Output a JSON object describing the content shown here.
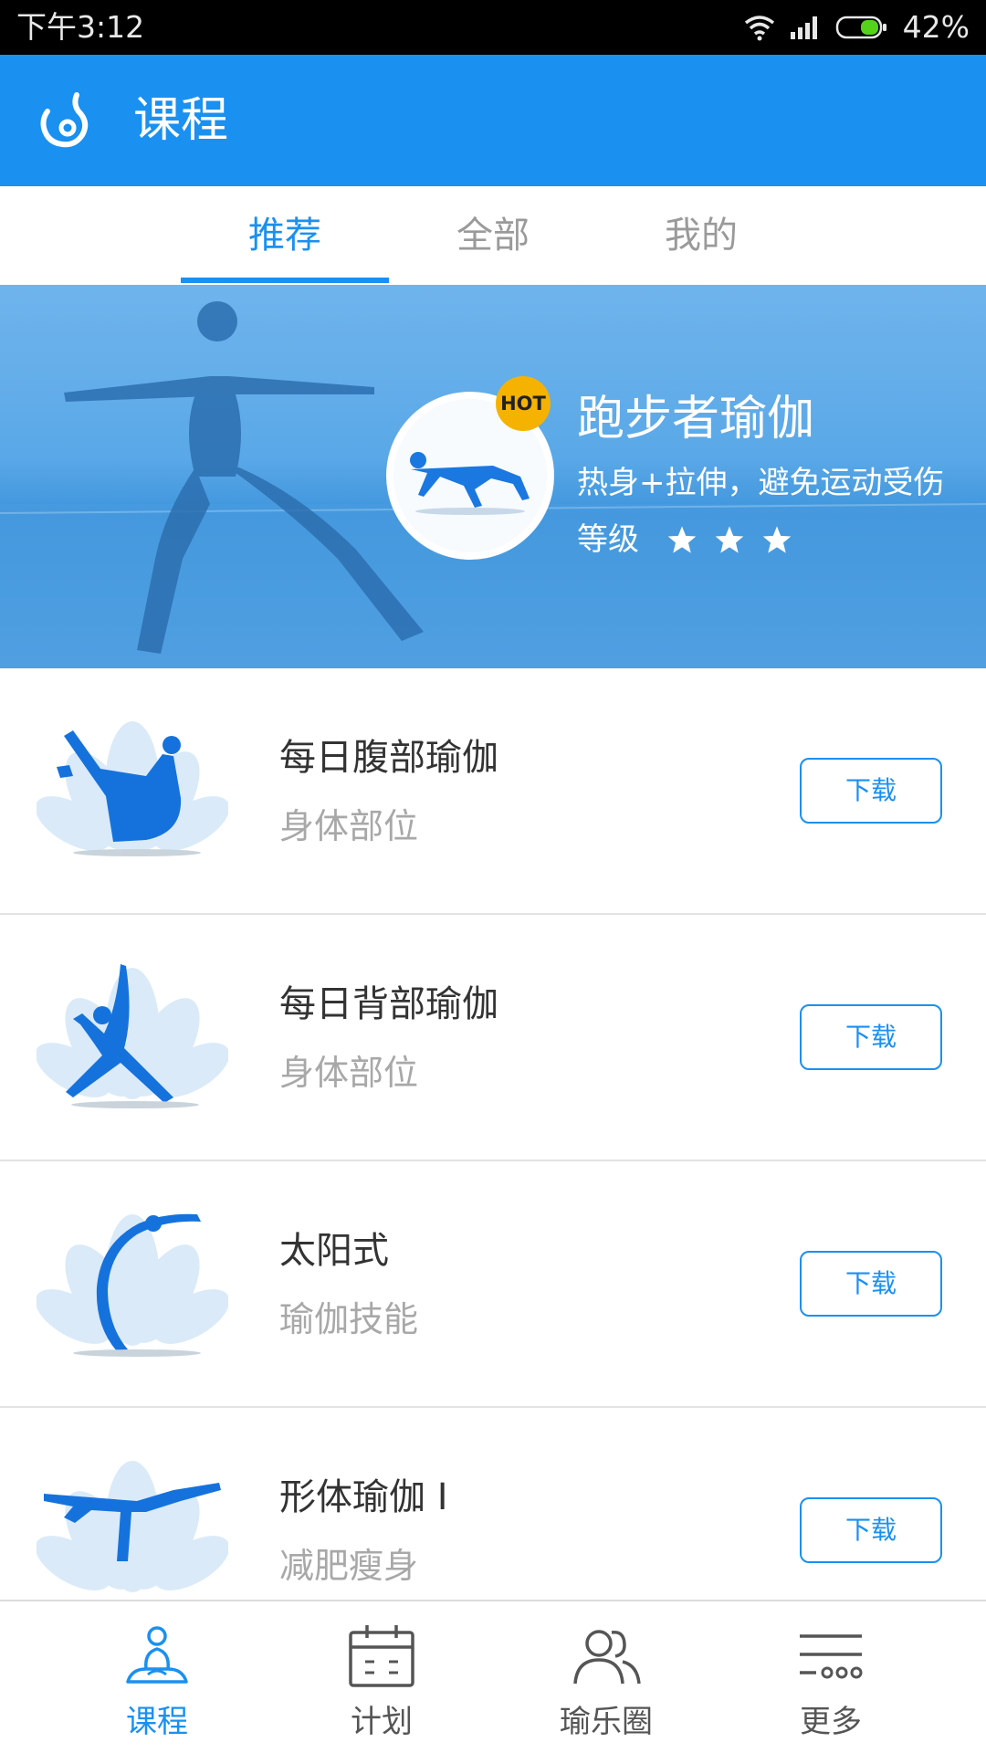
{
  "status_bar": {
    "time": "下午3:12",
    "battery": "42%"
  },
  "app_bar": {
    "title": "课程",
    "logo_icon": "drop-logo-icon"
  },
  "tabs": [
    {
      "label": "推荐",
      "active": true
    },
    {
      "label": "全部",
      "active": false
    },
    {
      "label": "我的",
      "active": false
    }
  ],
  "banner": {
    "hot": "HOT",
    "title": "跑步者瑜伽",
    "subtitle": "热身+拉伸，避免运动受伤",
    "level_label": "等级",
    "stars": 3,
    "page_count": 3,
    "active_page": 3
  },
  "courses": [
    {
      "name": "每日腹部瑜伽",
      "tag": "身体部位",
      "button": "下载"
    },
    {
      "name": "每日背部瑜伽",
      "tag": "身体部位",
      "button": "下载"
    },
    {
      "name": "太阳式",
      "tag": "瑜伽技能",
      "button": "下载"
    },
    {
      "name": "形体瑜伽 I",
      "tag": "减肥瘦身",
      "button": "下载"
    }
  ],
  "bottom_nav": [
    {
      "label": "课程",
      "icon": "meditation-icon",
      "active": true
    },
    {
      "label": "计划",
      "icon": "calendar-icon",
      "active": false
    },
    {
      "label": "瑜乐圈",
      "icon": "people-icon",
      "active": false
    },
    {
      "label": "更多",
      "icon": "more-lines-icon",
      "active": false
    }
  ],
  "colors": {
    "primary": "#1a90f0",
    "hot": "#f5b300",
    "text": "#333333",
    "muted": "#a8a8a8"
  }
}
